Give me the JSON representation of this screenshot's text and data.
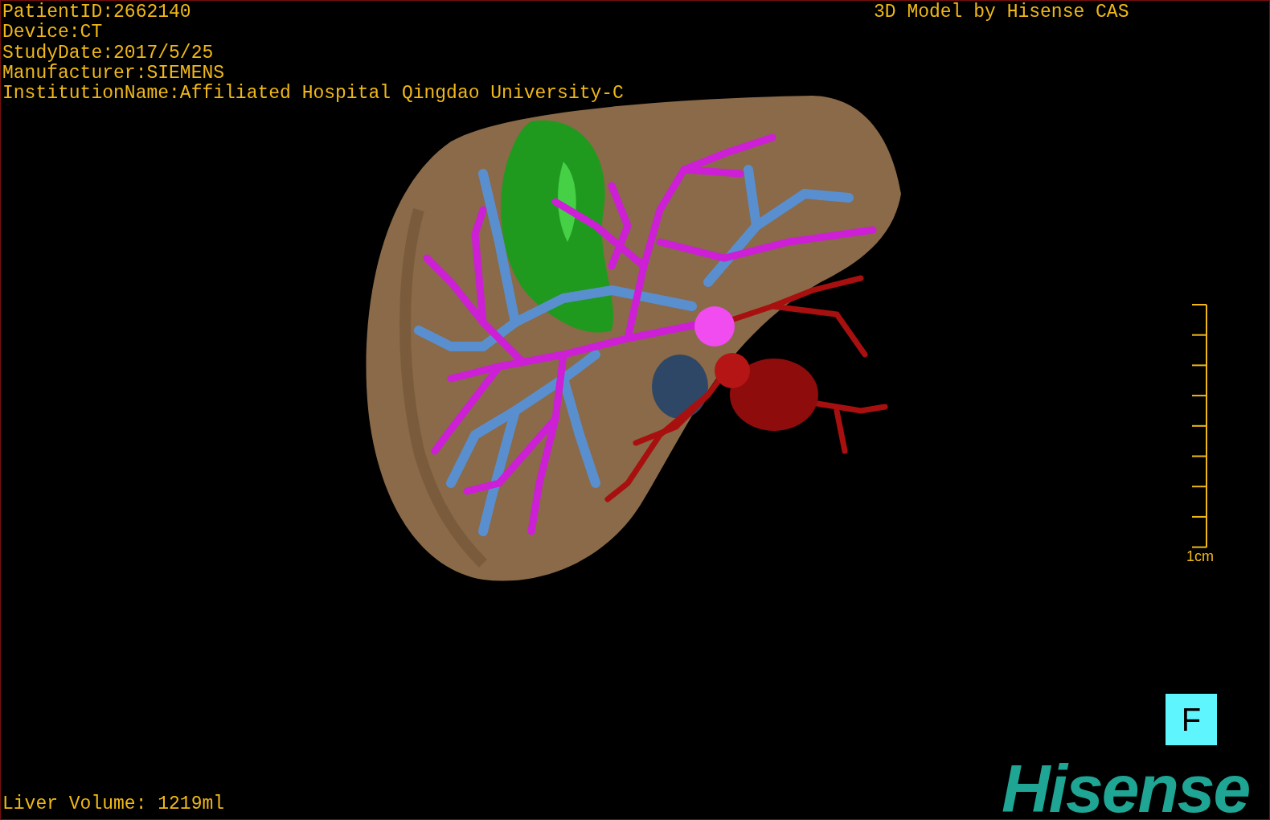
{
  "study_info": [
    "PatientID:2662140",
    "Device:CT",
    "StudyDate:2017/5/25",
    "Manufacturer:SIEMENS",
    "InstitutionName:Affiliated Hospital Qingdao University-C"
  ],
  "credit": "3D Model by Hisense CAS",
  "scale_bar": {
    "label": "1cm"
  },
  "orientation_button": "F",
  "liver_volume": "Liver Volume: 1219ml",
  "logo": "Hisense"
}
